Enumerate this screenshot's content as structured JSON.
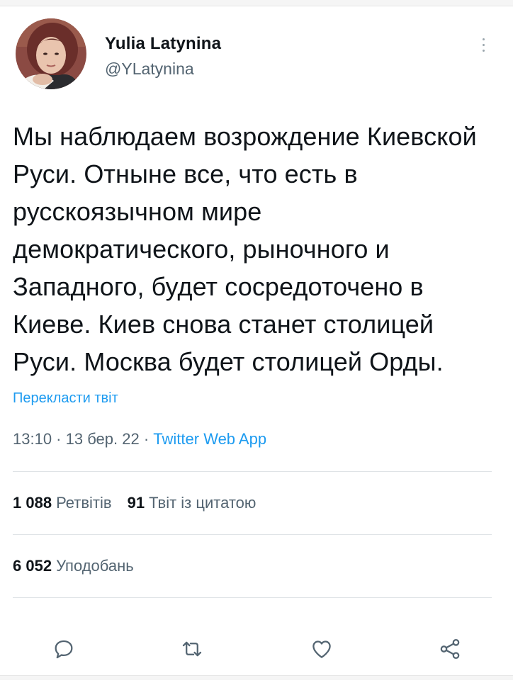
{
  "author": {
    "display_name": "Yulia Latynina",
    "handle": "@YLatynina"
  },
  "tweet": {
    "text": "Мы наблюдаем возрождение Киевской Руси. Отныне все, что есть в русскоязычном мире демократического, рыночного и Западного, будет сосредоточено в Киеве. Киев снова станет столицей Руси. Москва будет столицей Орды.",
    "translate_label": "Перекласти твіт",
    "time": "13:10",
    "date": "13 бер. 22",
    "separator": " · ",
    "source": "Twitter Web App"
  },
  "stats": {
    "retweets_count": "1 088",
    "retweets_label": "Ретвітів",
    "quotes_count": "91",
    "quotes_label": "Твіт із цитатою",
    "likes_count": "6 052",
    "likes_label": "Уподобань"
  },
  "icons": {
    "more": "more-vertical-icon",
    "reply": "reply-icon",
    "retweet": "retweet-icon",
    "like": "heart-icon",
    "share": "share-icon"
  },
  "colors": {
    "text": "#0f1419",
    "secondary": "#536471",
    "link": "#1d9bf0",
    "divider": "#dfe3e6"
  }
}
